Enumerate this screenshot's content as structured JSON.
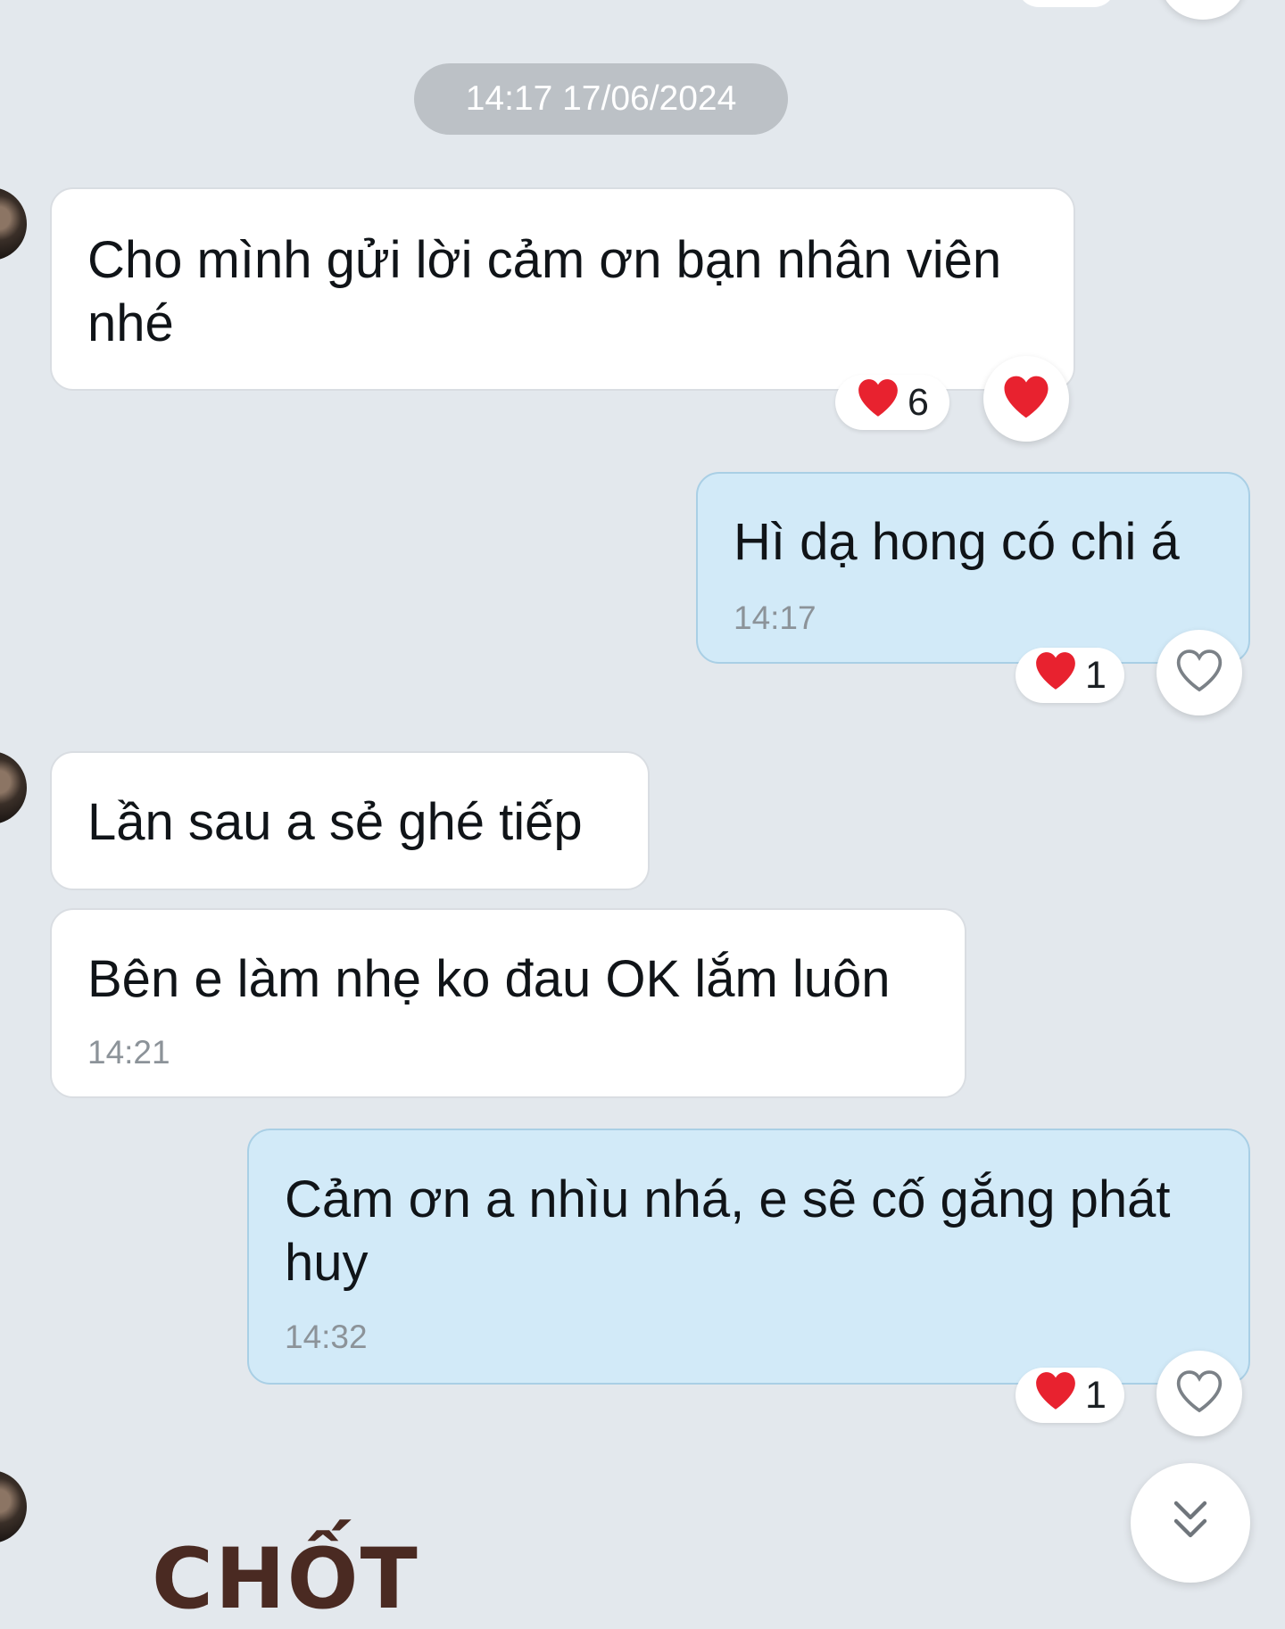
{
  "date_separator": "14:17 17/06/2024",
  "messages": [
    {
      "direction": "incoming",
      "lines": [
        "Cho mình gửi lời cảm ơn bạn nhân viên",
        "nhé"
      ],
      "reaction": {
        "icon": "heart-icon",
        "count": "6",
        "my_reaction": "heart-icon"
      }
    },
    {
      "direction": "outgoing",
      "lines": [
        "Hì dạ hong có chi á"
      ],
      "time": "14:17",
      "reaction": {
        "icon": "heart-icon",
        "count": "1",
        "my_reaction": "heart-outline-icon"
      }
    },
    {
      "direction": "incoming",
      "lines": [
        "Lần sau a sẻ ghé tiếp"
      ]
    },
    {
      "direction": "incoming",
      "lines": [
        "Bên e làm nhẹ ko đau OK lắm luôn"
      ],
      "time": "14:21"
    },
    {
      "direction": "outgoing",
      "lines": [
        "Cảm ơn a nhìu nhá, e sẽ cố gắng phát",
        "huy"
      ],
      "time": "14:32",
      "reaction": {
        "icon": "heart-icon",
        "count": "1",
        "my_reaction": "heart-outline-icon"
      }
    }
  ],
  "sticker": {
    "text": "CHỐT"
  },
  "scroll_button": {
    "icon": "double-chevron-down-icon"
  },
  "colors": {
    "background": "#e3e8ed",
    "incoming_bubble": "#ffffff",
    "outgoing_bubble": "#d2eaf8",
    "date_pill": "#bcc1c6",
    "heart": "#e8222f"
  }
}
